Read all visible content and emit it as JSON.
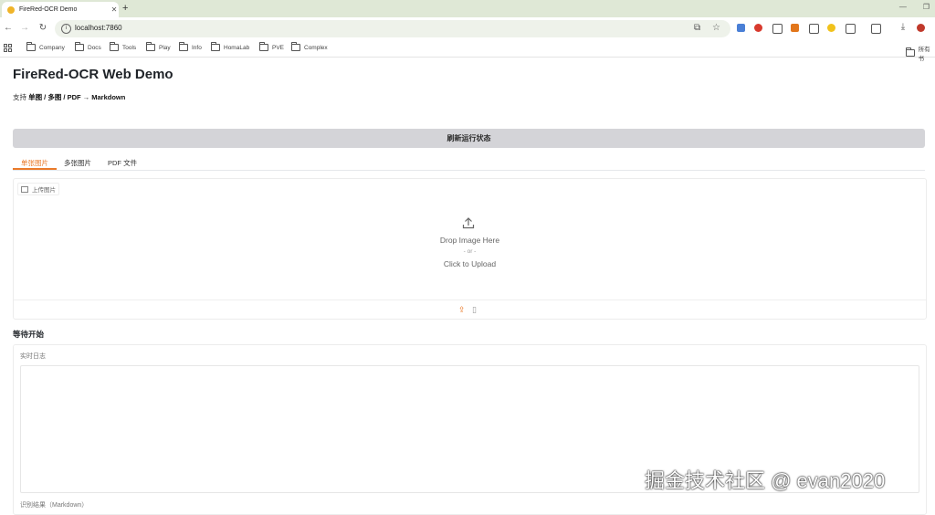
{
  "browser": {
    "tab_title": "FireRed-OCR Demo",
    "url": "localhost:7860",
    "bookmarks": [
      "Company",
      "Docs",
      "Tools",
      "Play",
      "Info",
      "HomaLab",
      "PVE",
      "Complex"
    ],
    "bookmarks_right": "所有书"
  },
  "app": {
    "title": "FireRed-OCR Web Demo",
    "subtitle_prefix": "支持",
    "subtitle_bold": "单图 / 多图 / PDF → Markdown",
    "refresh_button": "刷新运行状态",
    "tabs": [
      {
        "label": "单张图片",
        "active": true
      },
      {
        "label": "多张图片",
        "active": false
      },
      {
        "label": "PDF 文件",
        "active": false
      }
    ],
    "upload": {
      "label": "上传图片",
      "drop_title": "Drop Image Here",
      "drop_or": "- or -",
      "drop_click": "Click to Upload"
    },
    "status": "等待开始",
    "log_label": "实时日志",
    "result_label": "识别结果（Markdown）"
  },
  "watermark": "掘金技术社区 @ evan2020",
  "colors": {
    "accent": "#ea7a2a",
    "refresh_bg": "#d4d4d8"
  }
}
